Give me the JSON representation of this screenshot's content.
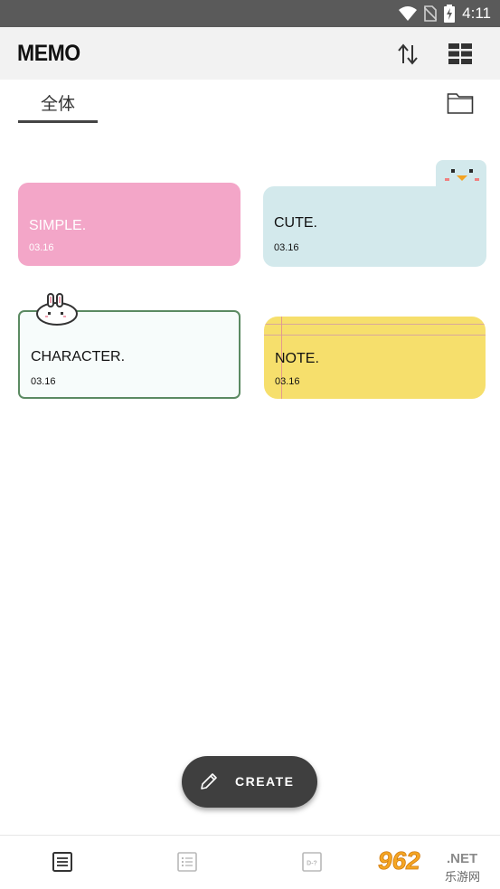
{
  "status_bar": {
    "time": "4:11",
    "icons": [
      "wifi-icon",
      "no-sim-icon",
      "battery-charging-icon"
    ]
  },
  "app_bar": {
    "title": "MEMO",
    "actions": [
      "sort-icon",
      "grid-view-icon"
    ]
  },
  "tabs": {
    "items": [
      {
        "label": "全体",
        "selected": true
      }
    ],
    "folder_icon": "folder-icon"
  },
  "memos": [
    {
      "title": "SIMPLE.",
      "date": "03.16",
      "style": "simple",
      "color": "#f3a6c8"
    },
    {
      "title": "CUTE.",
      "date": "03.16",
      "style": "cute",
      "color": "#d3e9ec"
    },
    {
      "title": "CHARACTER.",
      "date": "03.16",
      "style": "character",
      "color": "#f7fcfb"
    },
    {
      "title": "NOTE.",
      "date": "03.16",
      "style": "note",
      "color": "#f6df6c"
    }
  ],
  "fab": {
    "label": "CREATE",
    "icon": "pencil-icon"
  },
  "bottom_nav": {
    "items": [
      {
        "icon": "memo-icon",
        "active": true
      },
      {
        "icon": "list-icon",
        "active": false
      },
      {
        "icon": "dday-icon",
        "label": "D-?",
        "active": false
      }
    ]
  },
  "watermark": {
    "brand": "962",
    "suffix": ".NET",
    "subtitle": "乐游网"
  }
}
